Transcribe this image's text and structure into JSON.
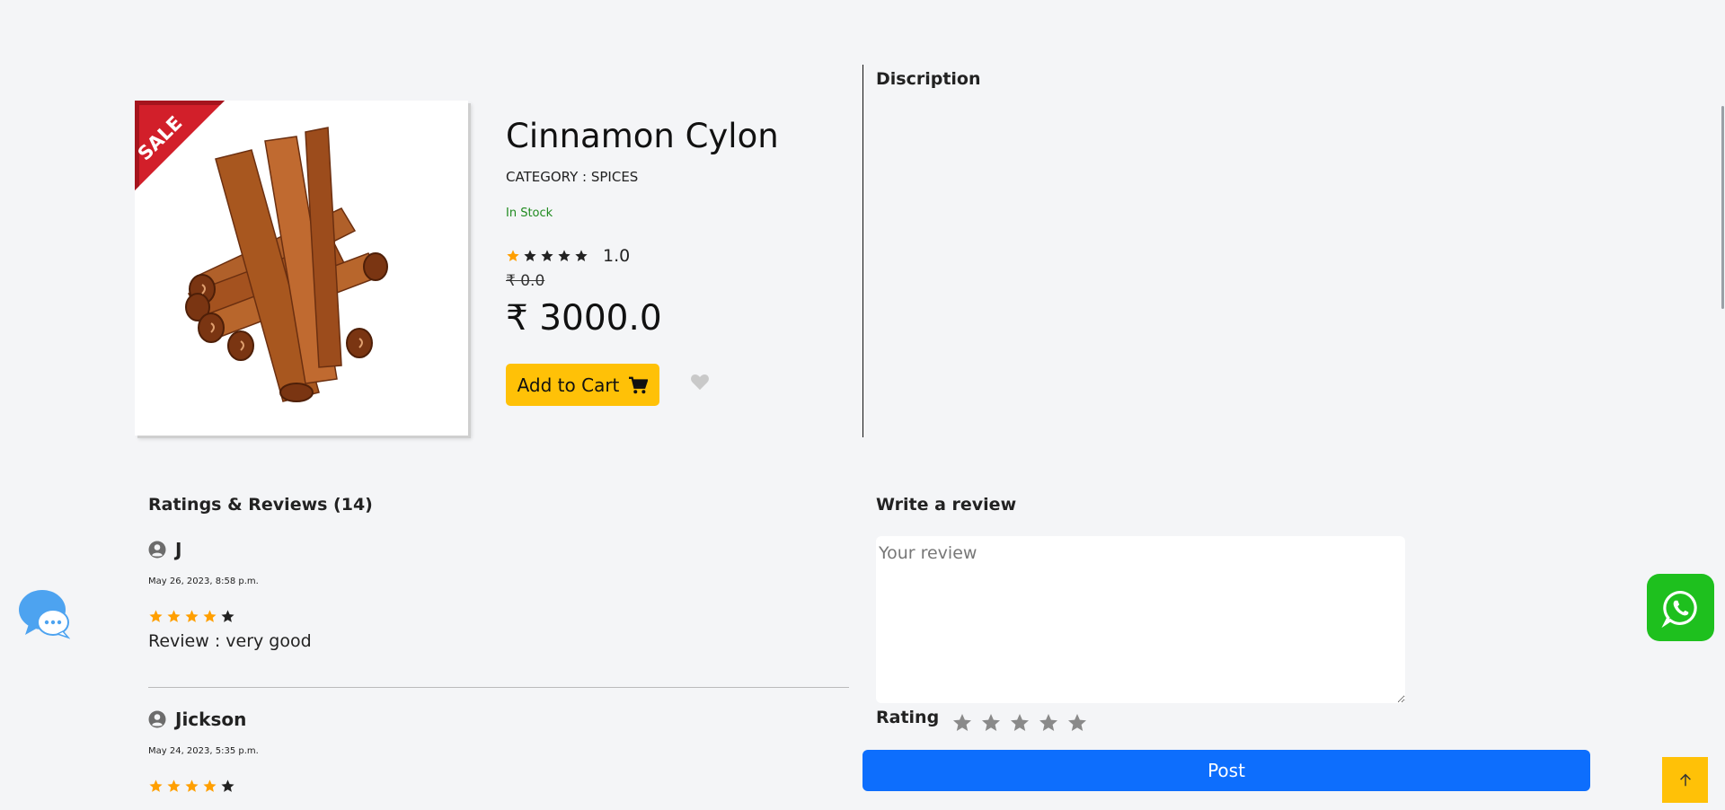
{
  "product": {
    "badge": "SALE",
    "title": "Cinnamon Cylon",
    "category": "CATEGORY : SPICES",
    "stock": "In Stock",
    "rating_value": "1.0",
    "rating_filled": 1,
    "rating_max": 5,
    "old_price": "₹ 0.0",
    "price": "₹ 3000.0",
    "add_to_cart_label": "Add to Cart",
    "cart_icon": "shopping-cart-icon",
    "wishlist_icon": "heart-icon"
  },
  "description": {
    "title": "Discription"
  },
  "reviews": {
    "title": "Ratings & Reviews (14)",
    "items": [
      {
        "user": "J",
        "date": "May 26, 2023, 8:58 p.m.",
        "stars": 4,
        "text": "Review : very good"
      },
      {
        "user": "Jickson",
        "date": "May 24, 2023, 5:35 p.m.",
        "stars": 4,
        "text": ""
      }
    ]
  },
  "write_review": {
    "title": "Write a review",
    "placeholder": "Your review",
    "rating_label": "Rating",
    "post_label": "Post"
  },
  "colors": {
    "accent": "#ffc107",
    "primary": "#0d6efd",
    "star_filled": "#ff9f00",
    "star_empty": "#222222",
    "in_stock": "#1f8a1f",
    "whatsapp": "#1ec01e"
  },
  "floating": {
    "chat_icon": "chat-bubble-icon",
    "whatsapp_icon": "whatsapp-icon",
    "back_to_top_icon": "arrow-up-icon"
  }
}
